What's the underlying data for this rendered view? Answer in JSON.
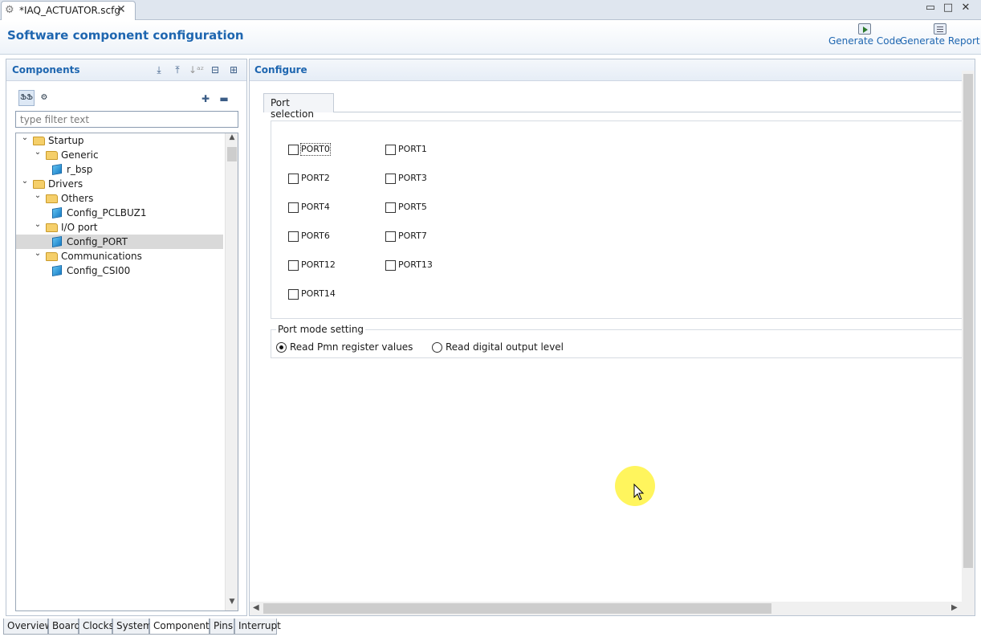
{
  "editor_tab": {
    "title": "*IAQ_ACTUATOR.scfg",
    "close": "✕"
  },
  "window_buttons": [
    "▭",
    "□",
    "✕"
  ],
  "header": {
    "title": "Software component configuration",
    "generate_code": "Generate Code",
    "generate_report": "Generate Report"
  },
  "components": {
    "title": "Components",
    "filter_placeholder": "type filter text",
    "tree": [
      {
        "label": "Startup",
        "kind": "folder",
        "level": 0
      },
      {
        "label": "Generic",
        "kind": "folder",
        "level": 1
      },
      {
        "label": "r_bsp",
        "kind": "component",
        "level": 2
      },
      {
        "label": "Drivers",
        "kind": "folder",
        "level": 0
      },
      {
        "label": "Others",
        "kind": "folder",
        "level": 1
      },
      {
        "label": "Config_PCLBUZ1",
        "kind": "component",
        "level": 2
      },
      {
        "label": "I/O port",
        "kind": "folder",
        "level": 1
      },
      {
        "label": "Config_PORT",
        "kind": "component",
        "level": 2,
        "selected": true
      },
      {
        "label": "Communications",
        "kind": "folder",
        "level": 1
      },
      {
        "label": "Config_CSI00",
        "kind": "component",
        "level": 2
      }
    ]
  },
  "configure": {
    "title": "Configure",
    "tab": "Port selection",
    "ports": [
      {
        "label": "PORT0",
        "checked": false
      },
      {
        "label": "PORT1",
        "checked": false
      },
      {
        "label": "PORT2",
        "checked": false
      },
      {
        "label": "PORT3",
        "checked": false
      },
      {
        "label": "PORT4",
        "checked": false
      },
      {
        "label": "PORT5",
        "checked": false
      },
      {
        "label": "PORT6",
        "checked": false
      },
      {
        "label": "PORT7",
        "checked": false
      },
      {
        "label": "PORT12",
        "checked": false
      },
      {
        "label": "PORT13",
        "checked": false
      },
      {
        "label": "PORT14",
        "checked": false
      }
    ],
    "mode": {
      "legend": "Port mode setting",
      "options": [
        {
          "label": "Read Pmn register values",
          "selected": true
        },
        {
          "label": "Read digital output level",
          "selected": false
        }
      ]
    }
  },
  "bottom_tabs": [
    "Overview",
    "Board",
    "Clocks",
    "System",
    "Components",
    "Pins",
    "Interrupt"
  ],
  "active_bottom_tab": "Components"
}
